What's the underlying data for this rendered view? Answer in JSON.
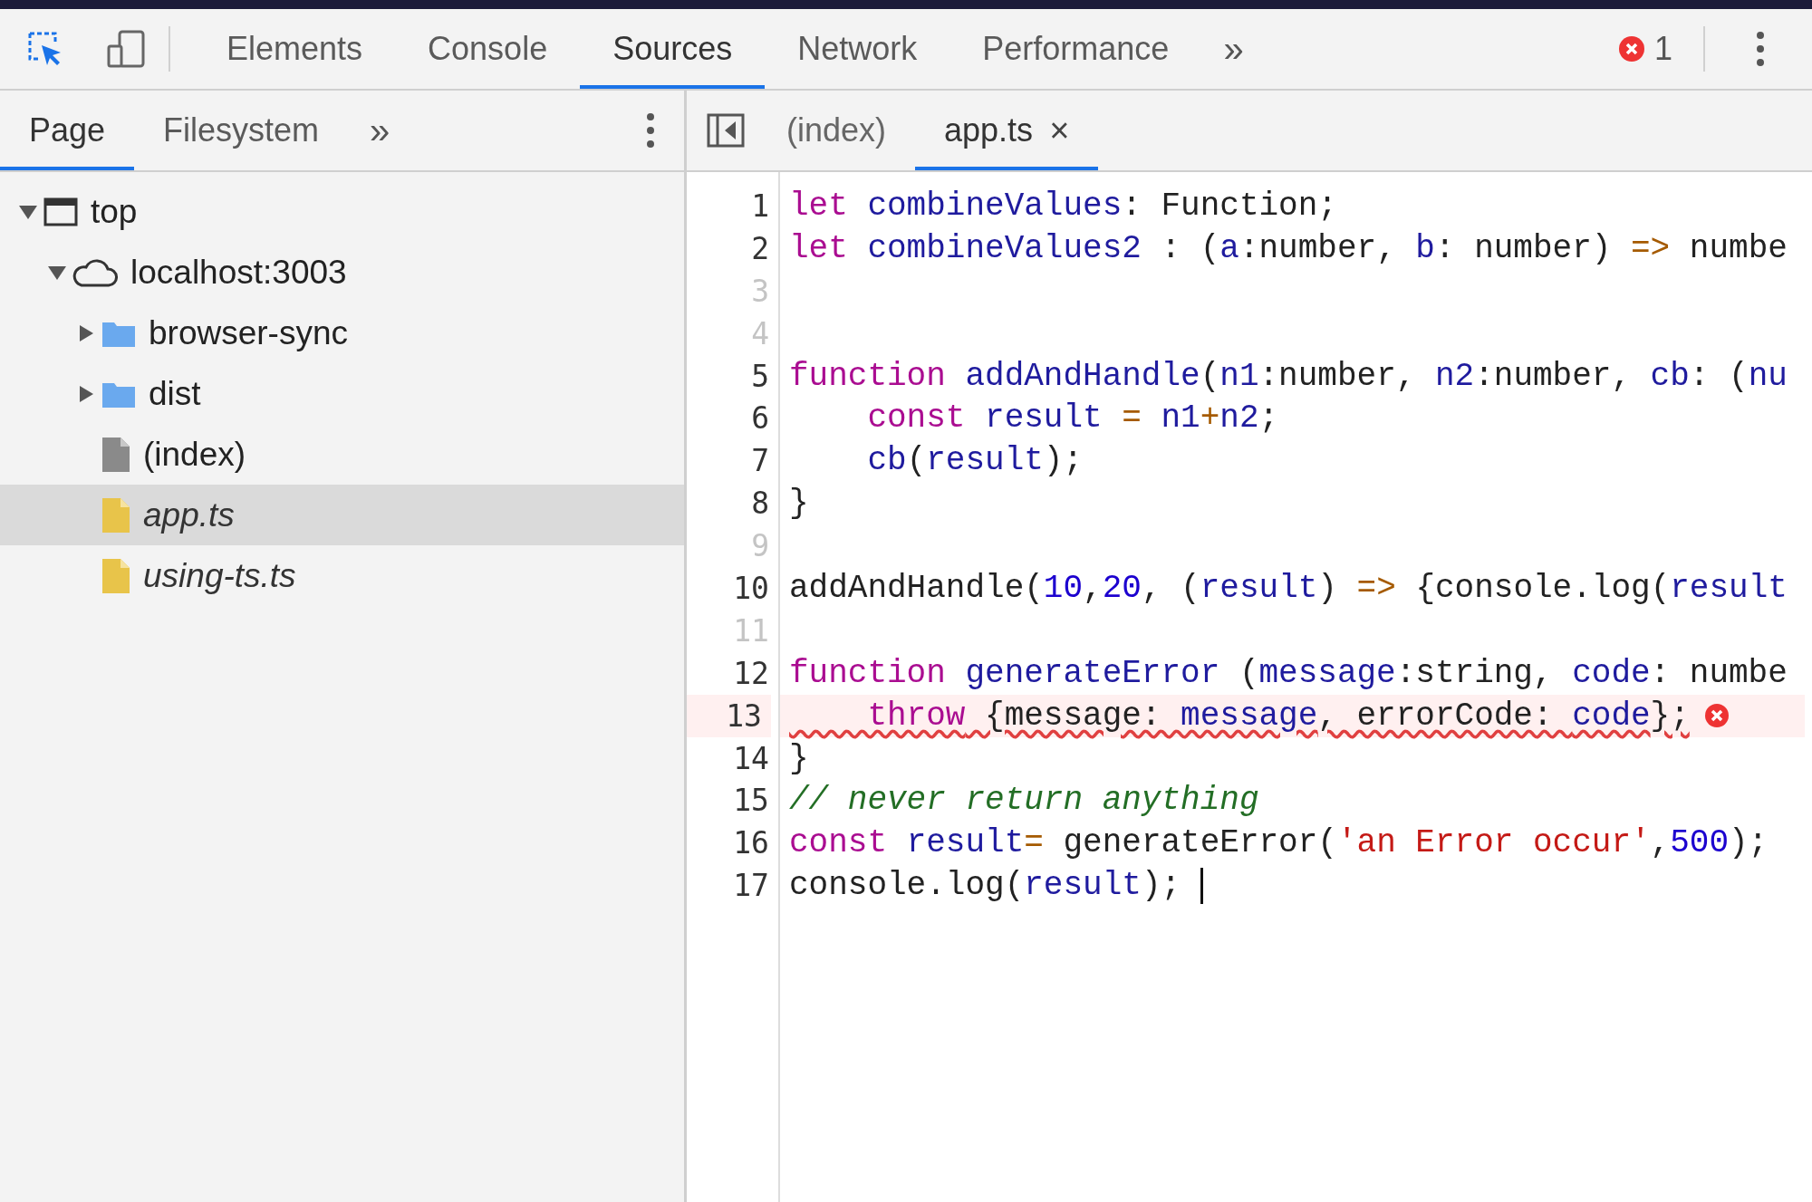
{
  "toolbar": {
    "tabs": [
      {
        "label": "Elements",
        "selected": false
      },
      {
        "label": "Console",
        "selected": false
      },
      {
        "label": "Sources",
        "selected": true
      },
      {
        "label": "Network",
        "selected": false
      },
      {
        "label": "Performance",
        "selected": false
      }
    ],
    "more": "»",
    "error_count": "1"
  },
  "navigator": {
    "tabs": [
      {
        "label": "Page",
        "selected": true
      },
      {
        "label": "Filesystem",
        "selected": false
      }
    ],
    "more": "»",
    "tree": [
      {
        "label": "top",
        "kind": "frame",
        "expanded": true,
        "selected": false,
        "children": [
          {
            "label": "localhost:3003",
            "kind": "domain",
            "expanded": true,
            "selected": false,
            "children": [
              {
                "label": "browser-sync",
                "kind": "folder",
                "expanded": false,
                "selected": false
              },
              {
                "label": "dist",
                "kind": "folder",
                "expanded": false,
                "selected": false
              },
              {
                "label": "(index)",
                "kind": "file",
                "selected": false
              },
              {
                "label": "app.ts",
                "kind": "mapped-file",
                "selected": true
              },
              {
                "label": "using-ts.ts",
                "kind": "mapped-file",
                "selected": false
              }
            ]
          }
        ]
      }
    ]
  },
  "editor": {
    "tabs": [
      {
        "label": "(index)",
        "selected": false,
        "closable": false
      },
      {
        "label": "app.ts",
        "selected": true,
        "closable": true
      }
    ],
    "close": "×",
    "lines": [
      {
        "number": "1",
        "muted": false,
        "error": false,
        "tokens": [
          {
            "kind": "keyword",
            "text": "let"
          },
          {
            "kind": "name",
            "text": " combineValues"
          },
          {
            "kind": "plain",
            "text": ": Function;"
          }
        ]
      },
      {
        "number": "2",
        "muted": false,
        "error": false,
        "tokens": [
          {
            "kind": "keyword",
            "text": "let"
          },
          {
            "kind": "name",
            "text": " combineValues2"
          },
          {
            "kind": "plain",
            "text": " : ("
          },
          {
            "kind": "name",
            "text": "a"
          },
          {
            "kind": "plain",
            "text": ":number, "
          },
          {
            "kind": "name",
            "text": "b"
          },
          {
            "kind": "plain",
            "text": ": number) "
          },
          {
            "kind": "operator",
            "text": "=>"
          },
          {
            "kind": "plain",
            "text": " numbe"
          }
        ]
      },
      {
        "number": "3",
        "muted": true,
        "error": false
      },
      {
        "number": "4",
        "muted": true,
        "error": false
      },
      {
        "number": "5",
        "muted": false,
        "error": false,
        "tokens": [
          {
            "kind": "keyword",
            "text": "function"
          },
          {
            "kind": "name",
            "text": " addAndHandle"
          },
          {
            "kind": "plain",
            "text": "("
          },
          {
            "kind": "name",
            "text": "n1"
          },
          {
            "kind": "plain",
            "text": ":number, "
          },
          {
            "kind": "name",
            "text": "n2"
          },
          {
            "kind": "plain",
            "text": ":number, "
          },
          {
            "kind": "name",
            "text": "cb"
          },
          {
            "kind": "plain",
            "text": ": ("
          },
          {
            "kind": "name",
            "text": "nu"
          }
        ]
      },
      {
        "number": "6",
        "muted": false,
        "error": false,
        "tokens": [
          {
            "kind": "keyword",
            "text": "    const"
          },
          {
            "kind": "name",
            "text": " result"
          },
          {
            "kind": "operator",
            "text": " ="
          },
          {
            "kind": "name",
            "text": " n1"
          },
          {
            "kind": "operator",
            "text": "+"
          },
          {
            "kind": "name",
            "text": "n2"
          },
          {
            "kind": "plain",
            "text": ";"
          }
        ]
      },
      {
        "number": "7",
        "muted": false,
        "error": false,
        "tokens": [
          {
            "kind": "name",
            "text": "    cb"
          },
          {
            "kind": "plain",
            "text": "("
          },
          {
            "kind": "name",
            "text": "result"
          },
          {
            "kind": "plain",
            "text": ");"
          }
        ]
      },
      {
        "number": "8",
        "muted": false,
        "error": false,
        "tokens": [
          {
            "kind": "plain",
            "text": "}"
          }
        ]
      },
      {
        "number": "9",
        "muted": true,
        "error": false
      },
      {
        "number": "10",
        "muted": false,
        "error": false,
        "tokens": [
          {
            "kind": "plain",
            "text": "addAndHandle("
          },
          {
            "kind": "number",
            "text": "10"
          },
          {
            "kind": "plain",
            "text": ","
          },
          {
            "kind": "number",
            "text": "20"
          },
          {
            "kind": "plain",
            "text": ", ("
          },
          {
            "kind": "name",
            "text": "result"
          },
          {
            "kind": "plain",
            "text": ") "
          },
          {
            "kind": "operator",
            "text": "=>"
          },
          {
            "kind": "plain",
            "text": " {console.log("
          },
          {
            "kind": "name",
            "text": "result"
          }
        ]
      },
      {
        "number": "11",
        "muted": true,
        "error": false
      },
      {
        "number": "12",
        "muted": false,
        "error": false,
        "tokens": [
          {
            "kind": "keyword",
            "text": "function"
          },
          {
            "kind": "name",
            "text": " generateError"
          },
          {
            "kind": "plain",
            "text": " ("
          },
          {
            "kind": "name",
            "text": "message"
          },
          {
            "kind": "plain",
            "text": ":string, "
          },
          {
            "kind": "name",
            "text": "code"
          },
          {
            "kind": "plain",
            "text": ": numbe"
          }
        ]
      },
      {
        "number": "13",
        "muted": false,
        "error": true,
        "tokens": [
          {
            "kind": "keyword",
            "text": "    throw"
          },
          {
            "kind": "plain",
            "text": " {message: "
          },
          {
            "kind": "name",
            "text": "message"
          },
          {
            "kind": "plain",
            "text": ", errorCode: "
          },
          {
            "kind": "name",
            "text": "code"
          },
          {
            "kind": "plain",
            "text": "};"
          }
        ]
      },
      {
        "number": "14",
        "muted": false,
        "error": false,
        "tokens": [
          {
            "kind": "plain",
            "text": "}"
          }
        ]
      },
      {
        "number": "15",
        "muted": false,
        "error": false,
        "tokens": [
          {
            "kind": "comment",
            "text": "// never return anything"
          }
        ]
      },
      {
        "number": "16",
        "muted": false,
        "error": false,
        "tokens": [
          {
            "kind": "keyword",
            "text": "const"
          },
          {
            "kind": "name",
            "text": " result"
          },
          {
            "kind": "operator",
            "text": "="
          },
          {
            "kind": "plain",
            "text": " generateError("
          },
          {
            "kind": "string",
            "text": "'an Error occur'"
          },
          {
            "kind": "plain",
            "text": ","
          },
          {
            "kind": "number",
            "text": "500"
          },
          {
            "kind": "plain",
            "text": ");"
          }
        ]
      },
      {
        "number": "17",
        "muted": false,
        "error": false,
        "cursor": true,
        "tokens": [
          {
            "kind": "plain",
            "text": "console.log("
          },
          {
            "kind": "name",
            "text": "result"
          },
          {
            "kind": "plain",
            "text": ");"
          }
        ]
      }
    ]
  }
}
